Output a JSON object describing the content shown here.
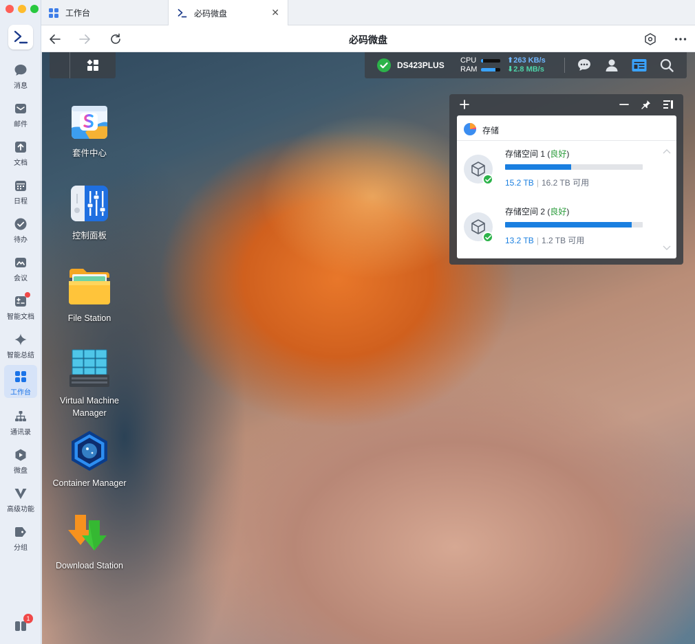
{
  "sidebar": {
    "items": [
      {
        "label": "消息",
        "icon": "chat-bubble-icon"
      },
      {
        "label": "邮件",
        "icon": "mail-icon"
      },
      {
        "label": "文档",
        "icon": "document-icon"
      },
      {
        "label": "日程",
        "icon": "calendar-icon"
      },
      {
        "label": "待办",
        "icon": "todo-check-icon"
      },
      {
        "label": "会议",
        "icon": "meeting-icon"
      },
      {
        "label": "智能文档",
        "icon": "smart-doc-icon"
      },
      {
        "label": "智能总结",
        "icon": "sparkle-icon"
      },
      {
        "label": "工作台",
        "icon": "workbench-grid-icon",
        "active": true
      },
      {
        "label": "通讯录",
        "icon": "org-chart-icon"
      },
      {
        "label": "微盘",
        "icon": "drive-icon"
      },
      {
        "label": "高级功能",
        "icon": "advanced-icon"
      },
      {
        "label": "分组",
        "icon": "tag-icon"
      }
    ],
    "bottom_badge": "1"
  },
  "browser": {
    "tabs": [
      {
        "label": "工作台",
        "active": false
      },
      {
        "label": "必码微盘",
        "active": true
      }
    ],
    "page_title": "必码微盘"
  },
  "dsm": {
    "taskbar": {
      "hostname": "DS423PLUS",
      "cpu_label": "CPU",
      "ram_label": "RAM",
      "cpu_level": 0.1,
      "ram_level": 0.75,
      "upload_rate": "263 KB/s",
      "download_rate": "2.8 MB/s"
    },
    "desktop_icons": [
      {
        "label": "套件中心",
        "icon": "package-center-icon"
      },
      {
        "label": "控制面板",
        "icon": "control-panel-icon"
      },
      {
        "label": "File Station",
        "icon": "file-station-icon"
      },
      {
        "label": "Virtual Machine Manager",
        "icon": "vmm-icon"
      },
      {
        "label": "Container Manager",
        "icon": "container-manager-icon"
      },
      {
        "label": "Download Station",
        "icon": "download-station-icon"
      }
    ],
    "storage_widget": {
      "title": "存储",
      "volumes": [
        {
          "name": "存储空间 1",
          "status": "良好",
          "used": "15.2 TB",
          "free": "16.2 TB 可用",
          "used_fraction": 0.48
        },
        {
          "name": "存储空间 2",
          "status": "良好",
          "used": "13.2 TB",
          "free": "1.2 TB 可用",
          "used_fraction": 0.92
        }
      ]
    }
  }
}
